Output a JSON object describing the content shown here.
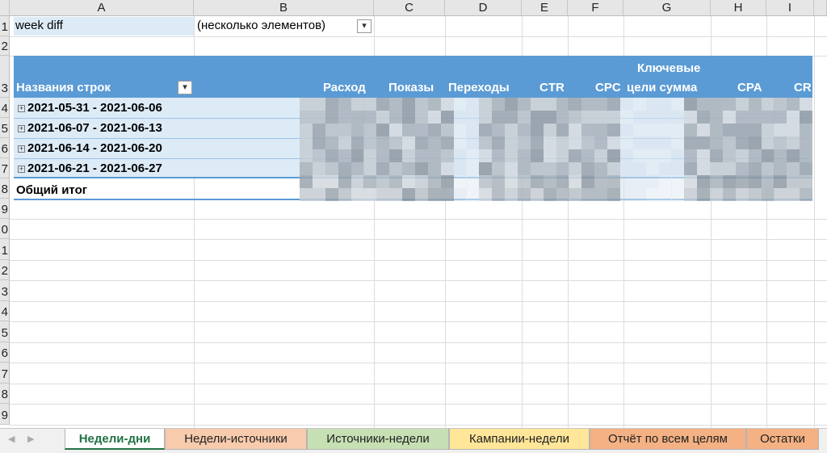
{
  "columns": [
    "A",
    "B",
    "C",
    "D",
    "E",
    "F",
    "G",
    "H",
    "I"
  ],
  "rows": [
    "1",
    "2",
    "3",
    "4",
    "5",
    "6",
    "7",
    "8",
    "9",
    "0",
    "1",
    "2",
    "3",
    "4",
    "5",
    "6",
    "7",
    "8",
    "9"
  ],
  "filter": {
    "field": "week diff",
    "value": "(несколько элементов)"
  },
  "pivot": {
    "row_label_header": "Названия строк",
    "headers": {
      "spend": "Расход",
      "impressions": "Показы",
      "clicks": "Переходы",
      "ctr": "CTR",
      "cpc": "CPC",
      "goals_line1": "Ключевые",
      "goals_line2": "цели сумма",
      "cpa": "CPA",
      "cr": "CR"
    },
    "rows": [
      "2021-05-31 - 2021-06-06",
      "2021-06-07 - 2021-06-13",
      "2021-06-14 - 2021-06-20",
      "2021-06-21 - 2021-06-27"
    ],
    "total_label": "Общий итог",
    "expand_glyph": "+",
    "filter_glyph": "▾"
  },
  "sheet_tabs": [
    {
      "label": "Недели-дни",
      "color": "#ffffff",
      "active": true
    },
    {
      "label": "Недели-источники",
      "color": "#f8cbad",
      "active": false
    },
    {
      "label": "Источники-недели",
      "color": "#c6e0b4",
      "active": false
    },
    {
      "label": "Кампании-недели",
      "color": "#ffe699",
      "active": false
    },
    {
      "label": "Отчёт по всем целям",
      "color": "#f4b183",
      "active": false
    },
    {
      "label": "Остатки",
      "color": "#f4b183",
      "active": false
    }
  ],
  "colors": {
    "accent": "#217346",
    "pivot_header": "#5b9bd5",
    "pivot_band": "#ddebf7"
  }
}
